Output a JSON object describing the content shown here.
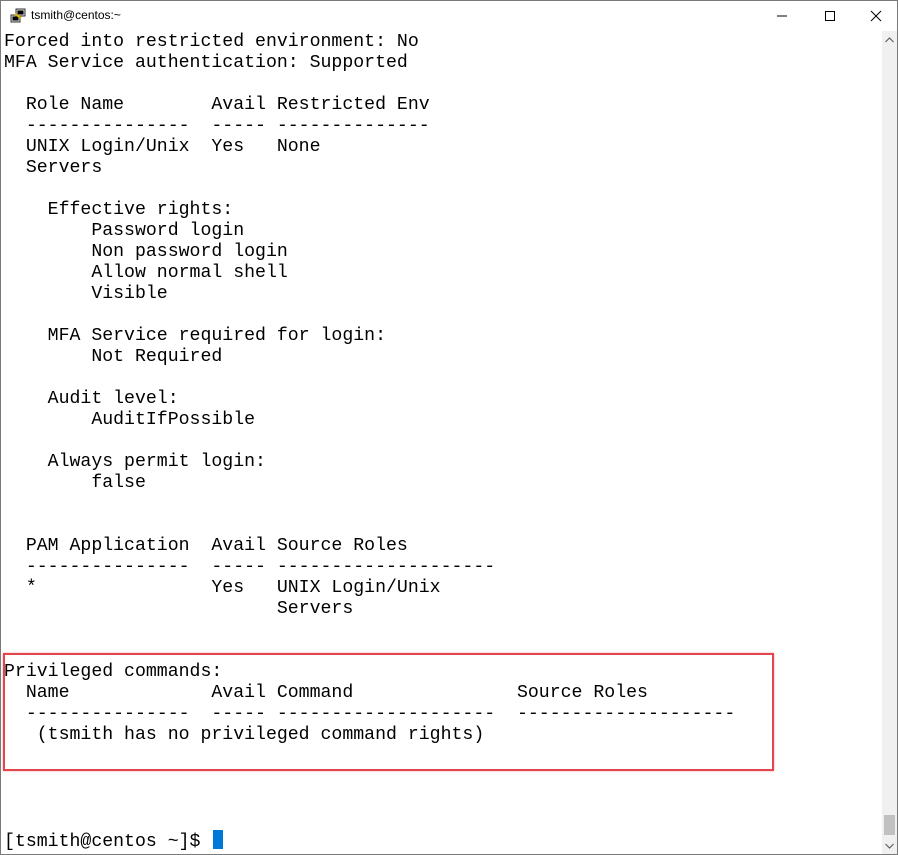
{
  "window": {
    "title": "tsmith@centos:~",
    "icon": "putty-icon"
  },
  "terminal": {
    "lines": [
      "Forced into restricted environment: No",
      "MFA Service authentication: Supported",
      "",
      "  Role Name        Avail Restricted Env",
      "  ---------------  ----- --------------",
      "  UNIX Login/Unix  Yes   None",
      "  Servers",
      "",
      "    Effective rights:",
      "        Password login",
      "        Non password login",
      "        Allow normal shell",
      "        Visible",
      "",
      "    MFA Service required for login:",
      "        Not Required",
      "",
      "    Audit level:",
      "        AuditIfPossible",
      "",
      "    Always permit login:",
      "        false",
      "",
      "",
      "  PAM Application  Avail Source Roles",
      "  ---------------  ----- --------------------",
      "  *                Yes   UNIX Login/Unix",
      "                         Servers",
      "",
      "",
      "Privileged commands:",
      "  Name             Avail Command               Source Roles",
      "  ---------------  ----- --------------------  --------------------",
      "   (tsmith has no privileged command rights)",
      "",
      "",
      "",
      "",
      ""
    ],
    "prompt": "[tsmith@centos ~]$ "
  },
  "colors": {
    "highlight_border": "#e0474c",
    "cursor": "#0078d7"
  }
}
